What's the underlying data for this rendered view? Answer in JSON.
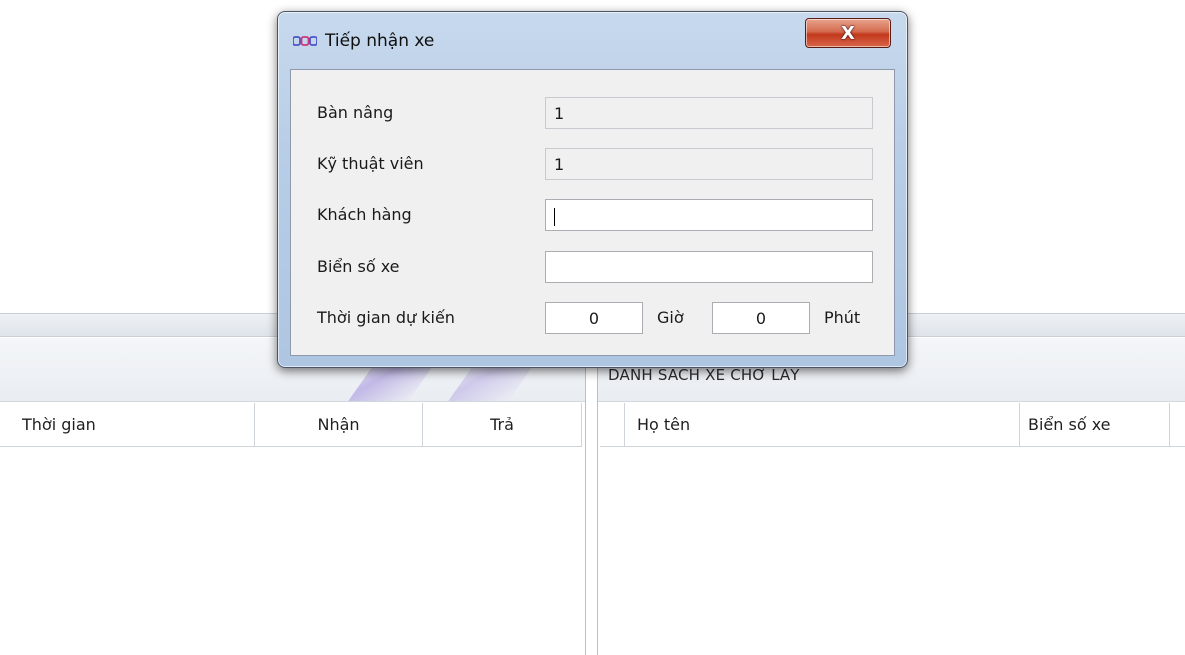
{
  "dialog": {
    "title": "Tiếp nhận xe",
    "close_glyph": "X",
    "fields": {
      "ban_nang": {
        "label": "Bàn nâng",
        "value": "1"
      },
      "ky_thuat_vien": {
        "label": "Kỹ thuật viên",
        "value": "1"
      },
      "khach_hang": {
        "label": "Khách hàng",
        "value": ""
      },
      "bien_so_xe": {
        "label": "Biển số xe",
        "value": ""
      },
      "thoi_gian": {
        "label": "Thời gian dự kiến",
        "hours": "0",
        "hours_unit": "Giờ",
        "minutes": "0",
        "minutes_unit": "Phút"
      }
    }
  },
  "background": {
    "left_grid": {
      "columns": [
        "Thời gian",
        "Nhận",
        "Trả"
      ]
    },
    "right_panel": {
      "caption": "DANH SÁCH XE CHỜ LẤY",
      "columns": [
        "Họ tên",
        "Biển số xe"
      ]
    }
  },
  "colors": {
    "close_button": "#c2391d",
    "dialog_frame": "#b8cde6",
    "client_bg": "#f0f0f0"
  }
}
